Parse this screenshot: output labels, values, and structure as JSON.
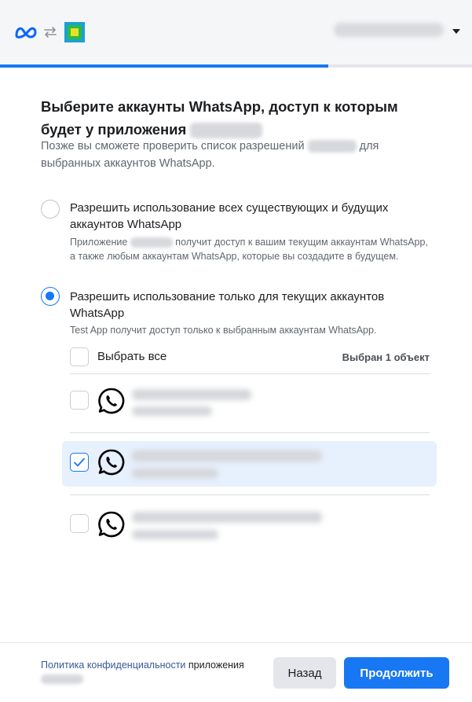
{
  "header": {
    "logo_icon": "meta-logo-icon",
    "swap_icon": "swap-arrows-icon",
    "app_icon": "app-icon",
    "dropdown_icon": "caret-down-icon",
    "progress_fraction": 0.695
  },
  "main": {
    "title_line1": "Выберите аккаунты WhatsApp, доступ к которым",
    "title_line2": "будет у приложения",
    "subtitle_part1": "Позже вы сможете проверить список разрешений",
    "subtitle_part2": "для",
    "subtitle_part3": "выбранных аккаунтов WhatsApp."
  },
  "options": [
    {
      "label": "Разрешить использование всех существующих и будущих аккаунтов WhatsApp",
      "desc_part1": "Приложение",
      "desc_part2": "получит доступ к вашим текущим аккаунтам WhatsApp, а также любым аккаунтам WhatsApp, которые вы создадите в будущем.",
      "selected": false
    },
    {
      "label": "Разрешить использование только для текущих аккаунтов WhatsApp",
      "desc": "Test App получит доступ только к выбранным аккаунтам WhatsApp.",
      "selected": true
    }
  ],
  "accounts": {
    "select_all_label": "Выбрать все",
    "selected_count": "Выбран 1 объект",
    "items": [
      {
        "checked": false,
        "icon": "whatsapp-icon"
      },
      {
        "checked": true,
        "icon": "whatsapp-icon"
      },
      {
        "checked": false,
        "icon": "whatsapp-icon"
      }
    ]
  },
  "footer": {
    "policy_link": "Политика конфиденциальности",
    "policy_suffix": "приложения",
    "back_label": "Назад",
    "continue_label": "Продолжить"
  },
  "colors": {
    "accent": "#1877f2",
    "selected_row_bg": "#e7f0fd",
    "header_bg": "#f5f6f7",
    "whatsapp_icon": "#000000"
  }
}
